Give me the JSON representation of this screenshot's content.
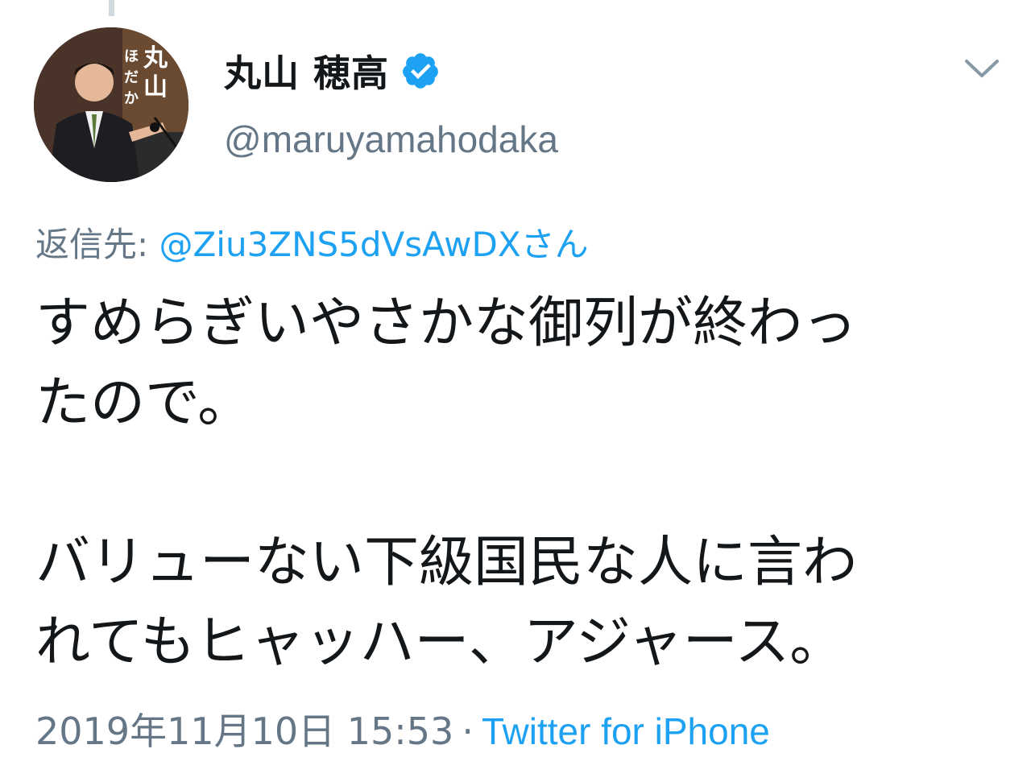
{
  "tweet": {
    "user": {
      "display_name": "丸山 穂高",
      "handle": "@maruyamahodaka",
      "verified_icon": "verified-badge-icon",
      "avatar_text": [
        "丸山",
        "ほだか"
      ]
    },
    "reply": {
      "prefix": "返信先: ",
      "target": "@Ziu3ZNS5dVsAwDXさん"
    },
    "text_lines": [
      "すめらぎいやさかな御列が終わっ",
      "たので。",
      "",
      "バリューない下級国民な人に言わ",
      "れてもヒャッハー、アジャース。"
    ],
    "timestamp": "2019年11月10日 15:53",
    "separator": "·",
    "source": "Twitter for iPhone",
    "menu_icon": "chevron-down-icon"
  },
  "colors": {
    "text_primary": "#14171a",
    "text_secondary": "#657786",
    "link_blue": "#1da1f2",
    "thread_line": "#cfd9de"
  }
}
